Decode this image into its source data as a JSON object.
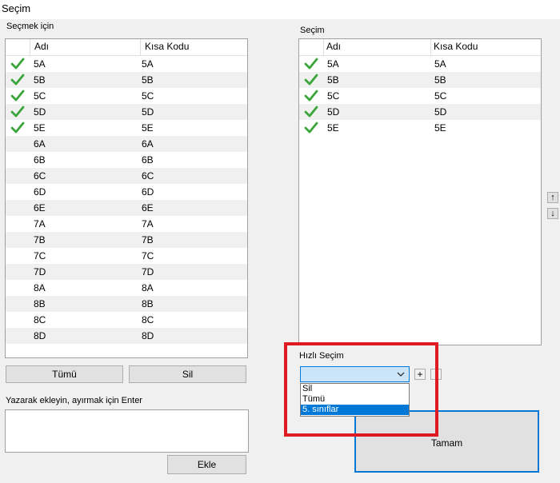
{
  "window": {
    "title": "Seçim"
  },
  "left": {
    "label": "Seçmek için",
    "columns": [
      "Adı",
      "Kısa Kodu"
    ],
    "rows": [
      {
        "name": "5A",
        "code": "5A",
        "checked": true
      },
      {
        "name": "5B",
        "code": "5B",
        "checked": true
      },
      {
        "name": "5C",
        "code": "5C",
        "checked": true
      },
      {
        "name": "5D",
        "code": "5D",
        "checked": true
      },
      {
        "name": "5E",
        "code": "5E",
        "checked": true
      },
      {
        "name": "6A",
        "code": "6A",
        "checked": false
      },
      {
        "name": "6B",
        "code": "6B",
        "checked": false
      },
      {
        "name": "6C",
        "code": "6C",
        "checked": false
      },
      {
        "name": "6D",
        "code": "6D",
        "checked": false
      },
      {
        "name": "6E",
        "code": "6E",
        "checked": false
      },
      {
        "name": "7A",
        "code": "7A",
        "checked": false
      },
      {
        "name": "7B",
        "code": "7B",
        "checked": false
      },
      {
        "name": "7C",
        "code": "7C",
        "checked": false
      },
      {
        "name": "7D",
        "code": "7D",
        "checked": false
      },
      {
        "name": "8A",
        "code": "8A",
        "checked": false
      },
      {
        "name": "8B",
        "code": "8B",
        "checked": false
      },
      {
        "name": "8C",
        "code": "8C",
        "checked": false
      },
      {
        "name": "8D",
        "code": "8D",
        "checked": false
      }
    ],
    "btn_all": "Tümü",
    "btn_delete": "Sil"
  },
  "right": {
    "label": "Seçim",
    "columns": [
      "Adı",
      "Kısa Kodu"
    ],
    "rows": [
      {
        "name": "5A",
        "code": "5A",
        "checked": true
      },
      {
        "name": "5B",
        "code": "5B",
        "checked": true
      },
      {
        "name": "5C",
        "code": "5C",
        "checked": true
      },
      {
        "name": "5D",
        "code": "5D",
        "checked": true
      },
      {
        "name": "5E",
        "code": "5E",
        "checked": true
      }
    ],
    "up_icon": "arrow-up-icon",
    "down_icon": "arrow-down-icon"
  },
  "add": {
    "label": "Yazarak ekleyin, ayırmak için Enter",
    "value": "",
    "btn_add": "Ekle"
  },
  "quick": {
    "label": "Hızlı Seçim",
    "selected": "",
    "options": [
      "Sil",
      "Tümü",
      "5. sınıflar"
    ],
    "highlighted": "5. sınıflar",
    "plus": "+",
    "minus": "-"
  },
  "ok_button": "Tamam",
  "colors": {
    "check": "#3aa53a",
    "highlight_box": "#e01a22",
    "accent": "#0078d7"
  }
}
